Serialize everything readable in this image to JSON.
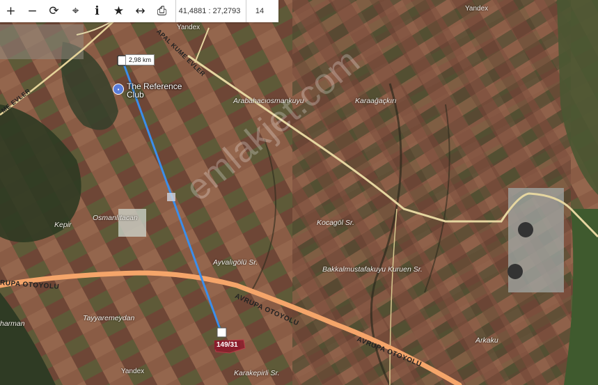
{
  "toolbar": {
    "zoom_in": "+",
    "zoom_out": "−",
    "refresh": "⟳",
    "locate": "⌖",
    "info": "i",
    "favorite": "★",
    "measure": "↔",
    "print": "⎙",
    "coordinates": "41,4881 : 27,2793",
    "zoom_level": "14"
  },
  "measure": {
    "distance": "2,98 km"
  },
  "poi": {
    "name": "The Reference Club"
  },
  "parcel": {
    "label": "149/31"
  },
  "places": {
    "arabaci": "Arabahacıosmankuyu",
    "karaagac": "Karaağaçkırı",
    "kepir": "Kepir",
    "osmanli": "Osmanlıtacan",
    "kocagol": "Kocagöl Sr.",
    "ayvaligolu": "Ayvalıgölü Sr.",
    "bakkal": "Bakkalmustafakuyu Kuruen Sr.",
    "tayyare": "Tayyaremeydan",
    "harman": "harman",
    "arkaku": "Arkaku",
    "karakepirli": "Karakepirli Sr."
  },
  "roads": {
    "otoyolu_left": "RUPA OTOYOLU",
    "otoyolu_mid": "AVRUPA OTOYOLU",
    "otoyolu_right": "AVRUPA OTOYOLU",
    "evler": "ME EVLER",
    "kume": "APAL KUME EVLER"
  },
  "attribution": {
    "yandex": "Yandex"
  },
  "watermark": "emlakjet.com"
}
